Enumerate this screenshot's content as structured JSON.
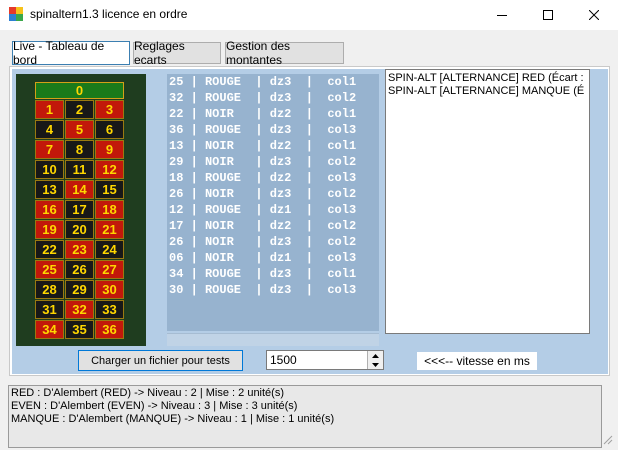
{
  "window": {
    "title": "spinaltern1.3 licence en ordre"
  },
  "tabs": [
    {
      "label": "Live - Tableau de bord",
      "active": true
    },
    {
      "label": "Reglages ecarts",
      "active": false
    },
    {
      "label": "Gestion des montantes",
      "active": false
    }
  ],
  "roulette": {
    "zero": "0",
    "rows": [
      [
        {
          "n": "1",
          "color": "red"
        },
        {
          "n": "2",
          "color": "black"
        },
        {
          "n": "3",
          "color": "red"
        }
      ],
      [
        {
          "n": "4",
          "color": "black"
        },
        {
          "n": "5",
          "color": "red"
        },
        {
          "n": "6",
          "color": "black"
        }
      ],
      [
        {
          "n": "7",
          "color": "red"
        },
        {
          "n": "8",
          "color": "black"
        },
        {
          "n": "9",
          "color": "red"
        }
      ],
      [
        {
          "n": "10",
          "color": "black"
        },
        {
          "n": "11",
          "color": "black"
        },
        {
          "n": "12",
          "color": "red"
        }
      ],
      [
        {
          "n": "13",
          "color": "black"
        },
        {
          "n": "14",
          "color": "red"
        },
        {
          "n": "15",
          "color": "black"
        }
      ],
      [
        {
          "n": "16",
          "color": "red"
        },
        {
          "n": "17",
          "color": "black"
        },
        {
          "n": "18",
          "color": "red"
        }
      ],
      [
        {
          "n": "19",
          "color": "red"
        },
        {
          "n": "20",
          "color": "black"
        },
        {
          "n": "21",
          "color": "red"
        }
      ],
      [
        {
          "n": "22",
          "color": "black"
        },
        {
          "n": "23",
          "color": "red"
        },
        {
          "n": "24",
          "color": "black"
        }
      ],
      [
        {
          "n": "25",
          "color": "red"
        },
        {
          "n": "26",
          "color": "black"
        },
        {
          "n": "27",
          "color": "red"
        }
      ],
      [
        {
          "n": "28",
          "color": "black"
        },
        {
          "n": "29",
          "color": "black"
        },
        {
          "n": "30",
          "color": "red"
        }
      ],
      [
        {
          "n": "31",
          "color": "black"
        },
        {
          "n": "32",
          "color": "red"
        },
        {
          "n": "33",
          "color": "black"
        }
      ],
      [
        {
          "n": "34",
          "color": "red"
        },
        {
          "n": "35",
          "color": "black"
        },
        {
          "n": "36",
          "color": "red"
        }
      ]
    ]
  },
  "spins": [
    {
      "num": "25",
      "color": "ROUGE",
      "dozen": "dz3",
      "column": "col1"
    },
    {
      "num": "32",
      "color": "ROUGE",
      "dozen": "dz3",
      "column": "col2"
    },
    {
      "num": "22",
      "color": "NOIR",
      "dozen": "dz2",
      "column": "col1"
    },
    {
      "num": "36",
      "color": "ROUGE",
      "dozen": "dz3",
      "column": "col3"
    },
    {
      "num": "13",
      "color": "NOIR",
      "dozen": "dz2",
      "column": "col1"
    },
    {
      "num": "29",
      "color": "NOIR",
      "dozen": "dz3",
      "column": "col2"
    },
    {
      "num": "18",
      "color": "ROUGE",
      "dozen": "dz2",
      "column": "col3"
    },
    {
      "num": "26",
      "color": "NOIR",
      "dozen": "dz3",
      "column": "col2"
    },
    {
      "num": "12",
      "color": "ROUGE",
      "dozen": "dz1",
      "column": "col3"
    },
    {
      "num": "17",
      "color": "NOIR",
      "dozen": "dz2",
      "column": "col2"
    },
    {
      "num": "26",
      "color": "NOIR",
      "dozen": "dz3",
      "column": "col2"
    },
    {
      "num": "06",
      "color": "NOIR",
      "dozen": "dz1",
      "column": "col3"
    },
    {
      "num": "34",
      "color": "ROUGE",
      "dozen": "dz3",
      "column": "col1"
    },
    {
      "num": "30",
      "color": "ROUGE",
      "dozen": "dz3",
      "column": "col3"
    }
  ],
  "alternances": [
    "SPIN-ALT  [ALTERNANCE]  RED (Écart :",
    "SPIN-ALT  [ALTERNANCE]  MANQUE (É"
  ],
  "controls": {
    "load_button": "Charger un fichier pour tests",
    "speed_value": "1500",
    "speed_label": "<<<-- vitesse en ms"
  },
  "log": [
    "RED : D'Alembert (RED) -> Niveau : 2 | Mise : 2 unité(s)",
    "EVEN : D'Alembert (EVEN) -> Niveau : 3 | Mise : 3 unité(s)",
    "MANQUE : D'Alembert (MANQUE) -> Niveau : 1 | Mise : 1 unité(s)"
  ],
  "colors": {
    "panel_bg": "#b4cde6",
    "spinlist_bg": "#97b3cf",
    "roulette_red": "#c2180a",
    "roulette_black": "#181818",
    "roulette_green": "#1a7a1a",
    "roulette_number": "#ffd700"
  },
  "icons": [
    "app-icon",
    "minimize-icon",
    "maximize-icon",
    "close-icon",
    "chevron-up-icon",
    "chevron-down-icon",
    "resize-grip-icon"
  ]
}
